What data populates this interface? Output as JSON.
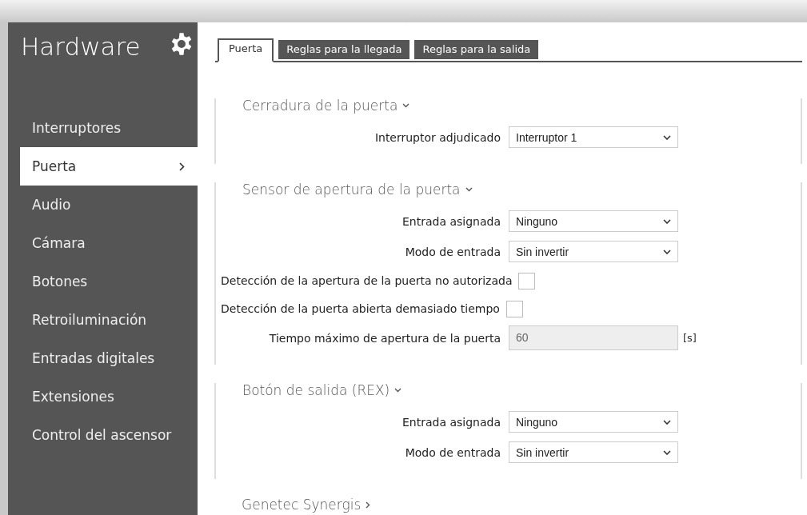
{
  "sidebar": {
    "title": "Hardware",
    "items": [
      {
        "label": "Interruptores",
        "selected": false
      },
      {
        "label": "Puerta",
        "selected": true
      },
      {
        "label": "Audio",
        "selected": false
      },
      {
        "label": "Cámara",
        "selected": false
      },
      {
        "label": "Botones",
        "selected": false
      },
      {
        "label": "Retroiluminación",
        "selected": false
      },
      {
        "label": "Entradas digitales",
        "selected": false
      },
      {
        "label": "Extensiones",
        "selected": false
      },
      {
        "label": "Control del ascensor",
        "selected": false
      }
    ]
  },
  "tabs": [
    {
      "label": "Puerta",
      "selected": true
    },
    {
      "label": "Reglas para la llegada",
      "selected": false
    },
    {
      "label": "Reglas para la salida",
      "selected": false
    }
  ],
  "sections": [
    {
      "title": "Cerradura de la puerta",
      "expanded": true,
      "rows": [
        {
          "kind": "select",
          "label": "Interruptor adjudicado",
          "value": "Interruptor 1"
        }
      ]
    },
    {
      "title": "Sensor de apertura de la puerta",
      "expanded": true,
      "rows": [
        {
          "kind": "select",
          "label": "Entrada asignada",
          "value": "Ninguno"
        },
        {
          "kind": "select",
          "label": "Modo de entrada",
          "value": "Sin invertir"
        },
        {
          "kind": "checkbox",
          "label": "Detección de la apertura de la puerta no autorizada",
          "checked": false
        },
        {
          "kind": "checkbox",
          "label": "Detección de la puerta abierta demasiado tiempo",
          "checked": false
        },
        {
          "kind": "input",
          "label": "Tiempo máximo de apertura de la puerta",
          "value": "60",
          "disabled": true,
          "unit": "[s]"
        }
      ]
    },
    {
      "title": "Botón de salida (REX)",
      "expanded": true,
      "rows": [
        {
          "kind": "select",
          "label": "Entrada asignada",
          "value": "Ninguno"
        },
        {
          "kind": "select",
          "label": "Modo de entrada",
          "value": "Sin invertir"
        }
      ]
    },
    {
      "title": "Genetec Synergis",
      "expanded": false
    }
  ]
}
